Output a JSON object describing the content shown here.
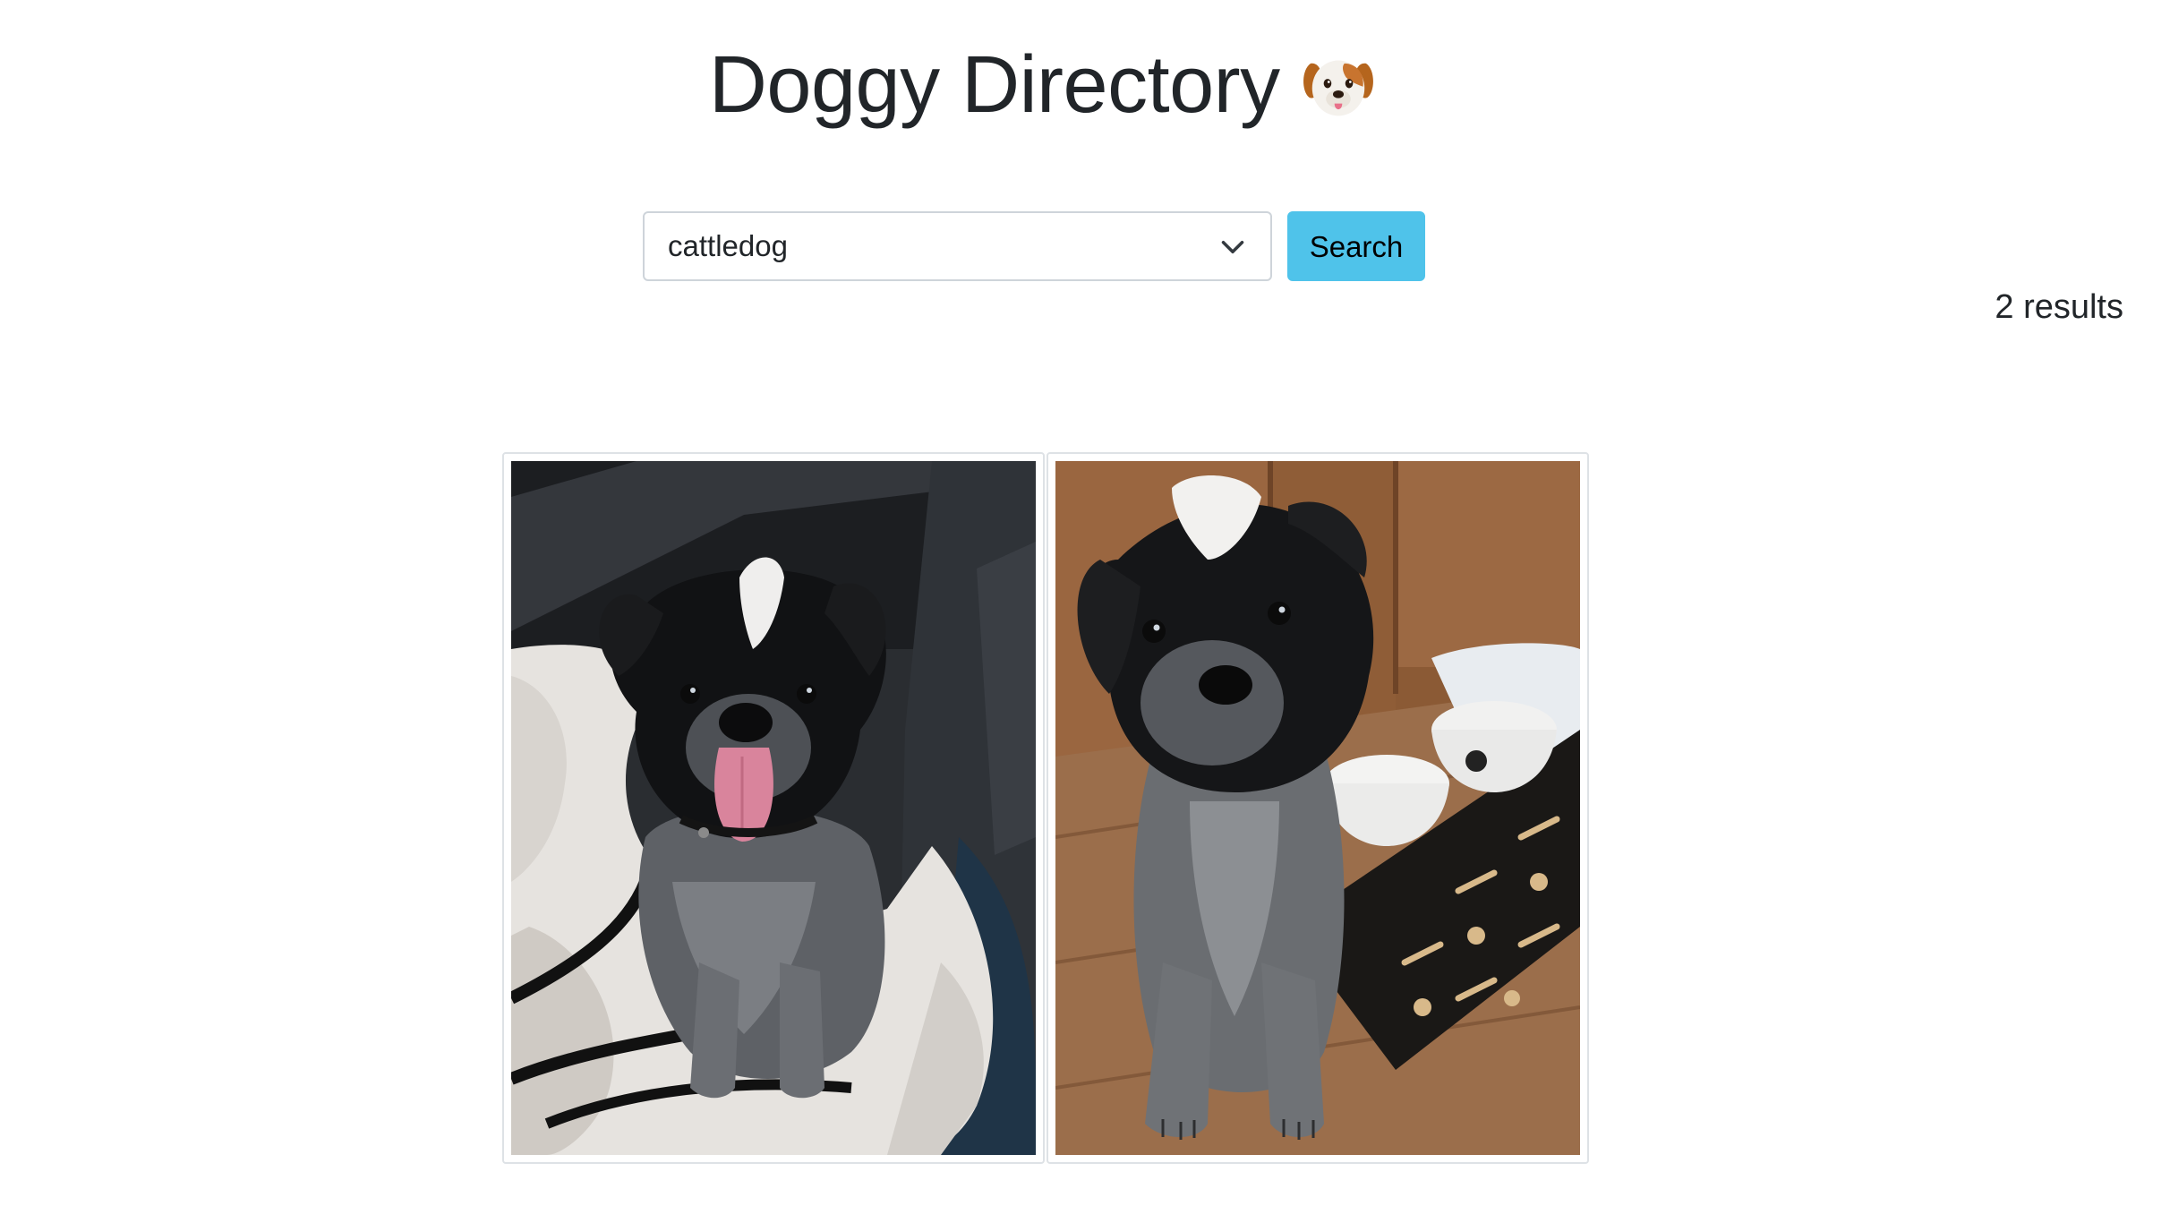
{
  "header": {
    "title": "Doggy Directory",
    "icon": "dog-face-icon"
  },
  "search": {
    "selected_breed": "cattledog",
    "button_label": "Search"
  },
  "results": {
    "count_text": "2 results",
    "images": [
      {
        "alt": "Cattle dog puppy sitting in a car seat bed with tongue out"
      },
      {
        "alt": "Cattle dog puppy sitting on wood floor near food bowls"
      }
    ]
  },
  "colors": {
    "accent": "#4fc3ea",
    "text": "#212529",
    "border": "#ced4da"
  }
}
